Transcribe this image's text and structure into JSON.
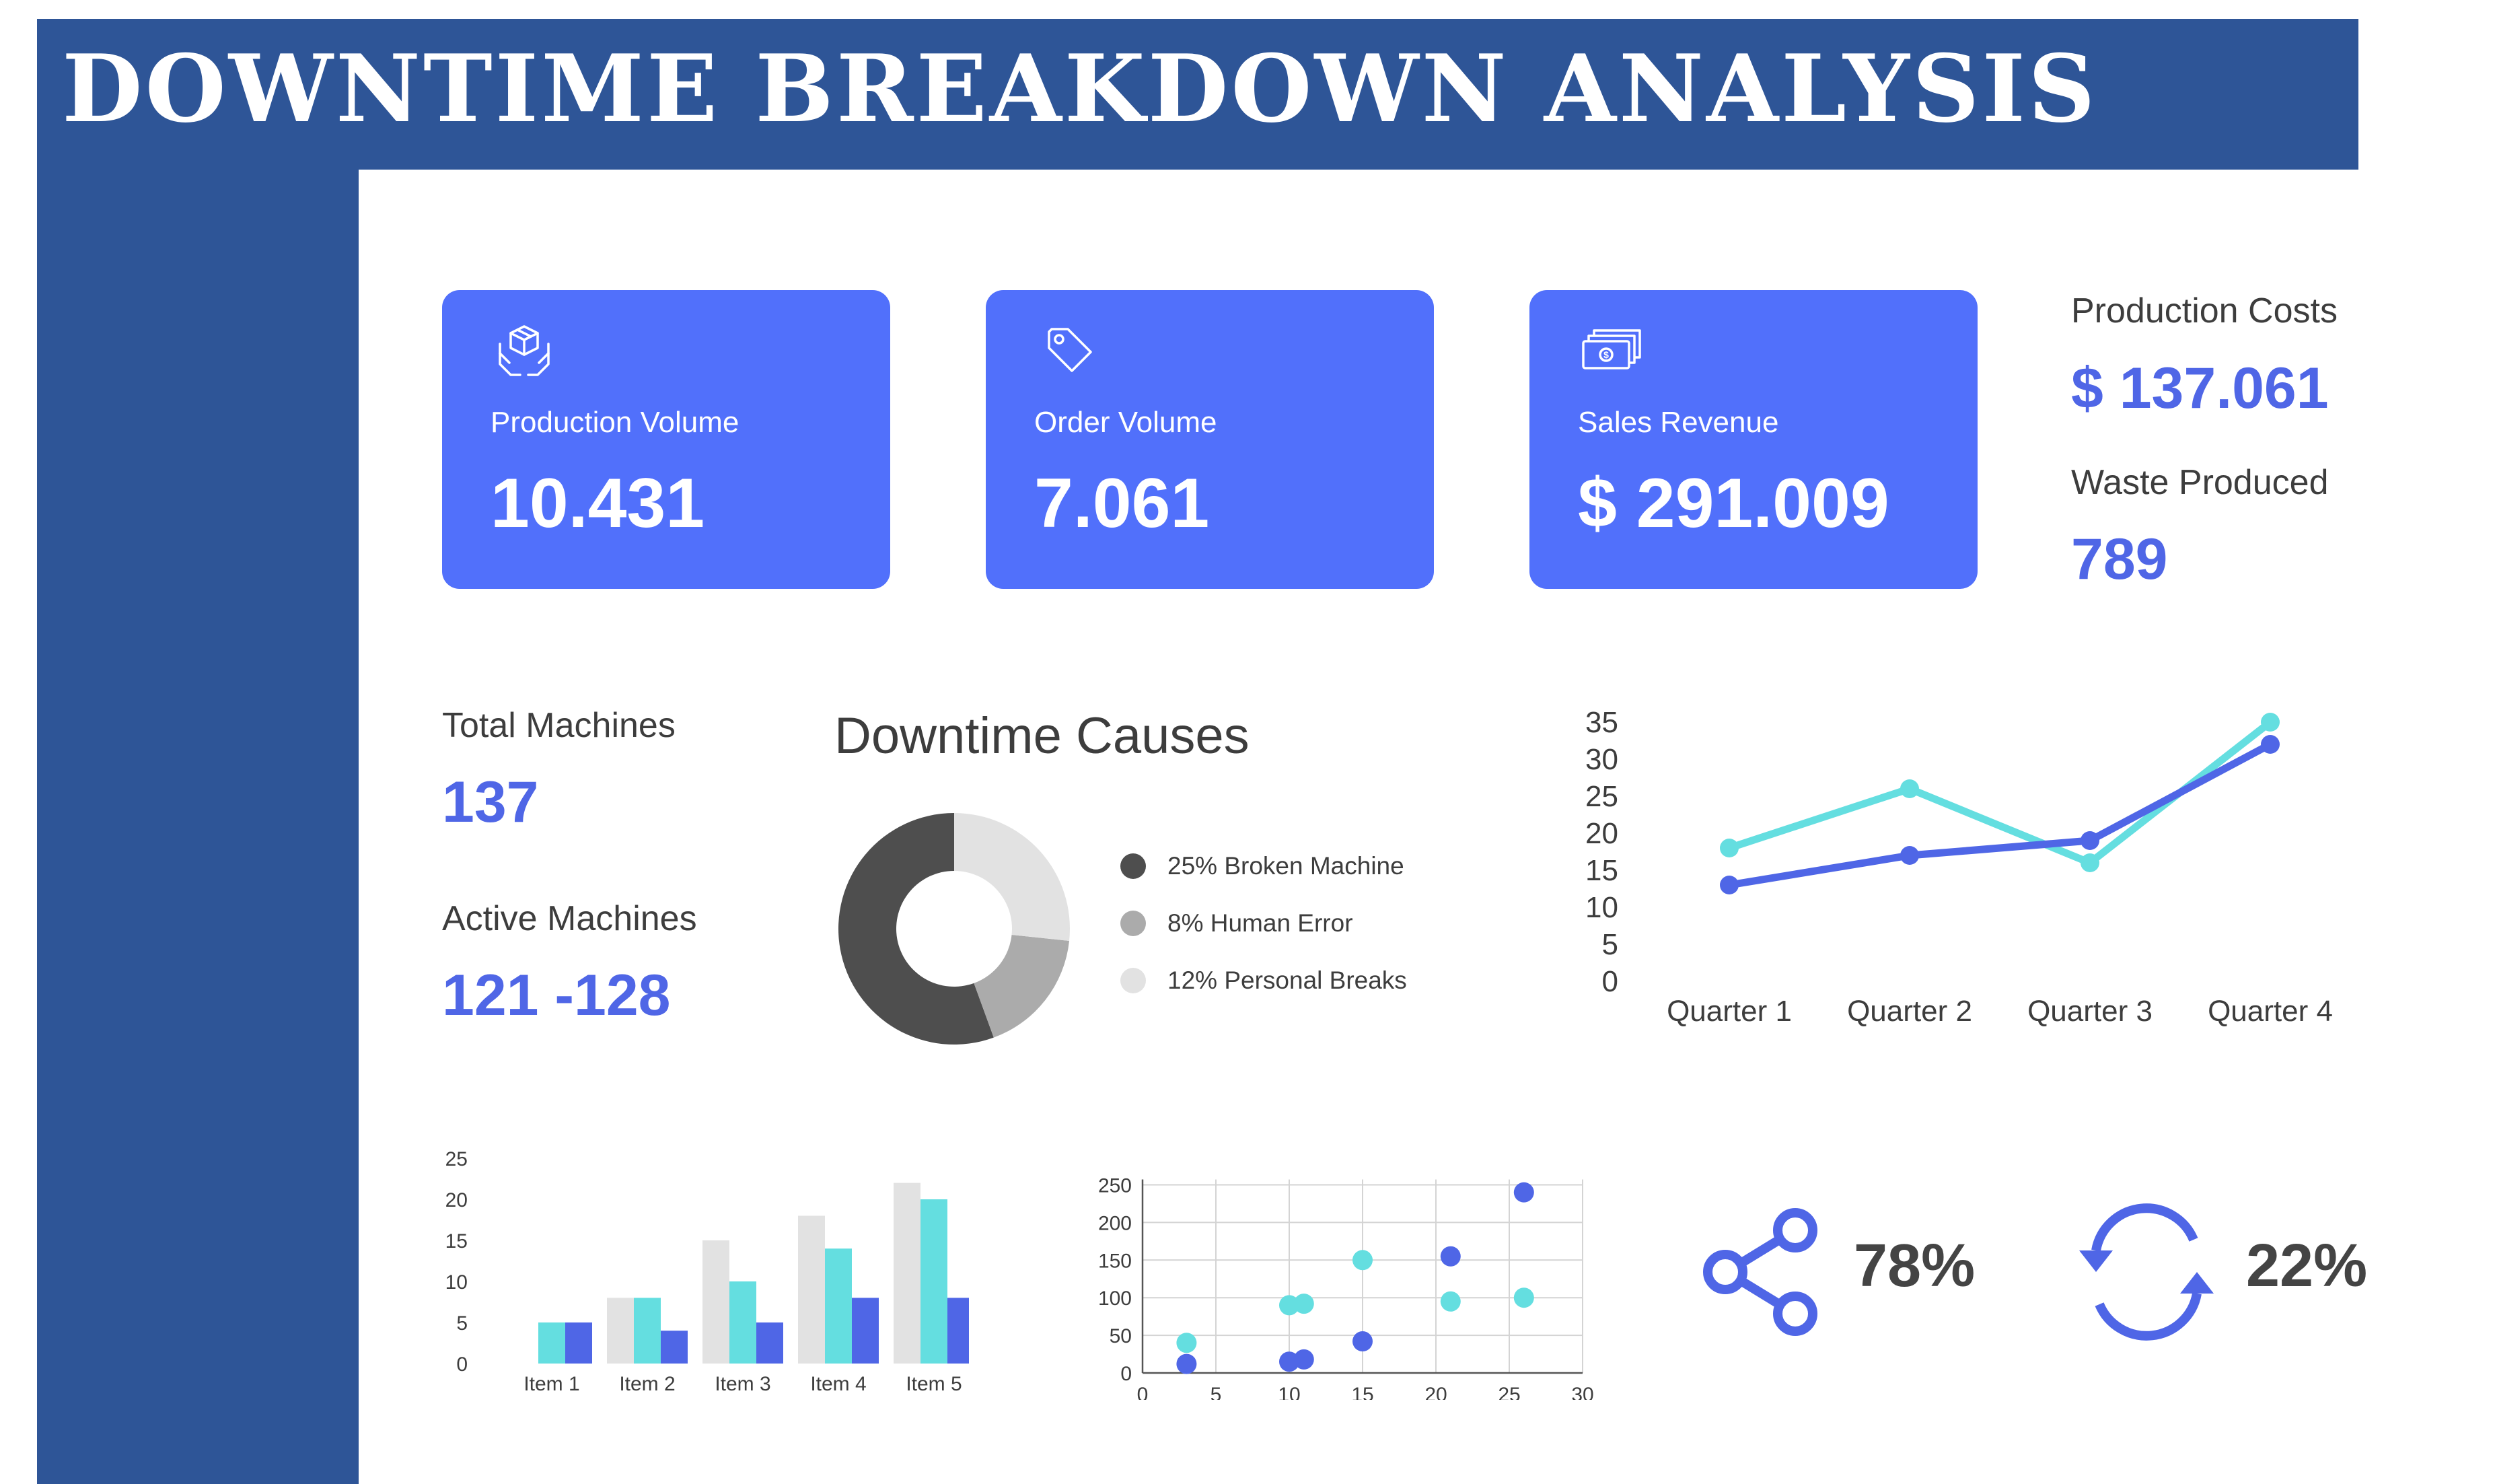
{
  "header": {
    "title": "Downtime Breakdown Analysis"
  },
  "colors": {
    "frame": "#2E5597",
    "card": "#5170FB",
    "accent_blue": "#4F66E6",
    "teal": "#64DEE0",
    "dark": "#4E4E4E",
    "mid_gray": "#ABABAB",
    "light_gray": "#E2E2E2"
  },
  "kpis": [
    {
      "icon": "hands-box-icon",
      "label": "Production Volume",
      "value": "10.431"
    },
    {
      "icon": "price-tag-icon",
      "label": "Order Volume",
      "value": "7.061"
    },
    {
      "icon": "cash-stack-icon",
      "label": "Sales Revenue",
      "value": "$ 291.009"
    }
  ],
  "side_stats": {
    "production_costs": {
      "label": "Production Costs",
      "value": "$ 137.061"
    },
    "waste_produced": {
      "label": "Waste Produced",
      "value": "789"
    }
  },
  "machines": {
    "total": {
      "label": "Total Machines",
      "value": "137"
    },
    "active": {
      "label": "Active Machines",
      "value": "121 -128"
    }
  },
  "shares": [
    {
      "icon": "share-icon",
      "value": "78%"
    },
    {
      "icon": "refresh-icon",
      "value": "22%"
    }
  ],
  "chart_data": [
    {
      "type": "pie",
      "title": "Downtime Causes",
      "donut": true,
      "slices": [
        {
          "label": "25% Broken Machine",
          "value": 25,
          "color": "#4E4E4E"
        },
        {
          "label": "8% Human Error",
          "value": 8,
          "color": "#ABABAB"
        },
        {
          "label": "12% Personal Breaks",
          "value": 12,
          "color": "#E2E2E2"
        }
      ],
      "legend": "right"
    },
    {
      "type": "line",
      "categories": [
        "Quarter 1",
        "Quarter 2",
        "Quarter 3",
        "Quarter 4"
      ],
      "series": [
        {
          "values": [
            18,
            26,
            16,
            35
          ],
          "color": "#64DEE0"
        },
        {
          "values": [
            13,
            17,
            19,
            32
          ],
          "color": "#4F66E6"
        }
      ],
      "ylim": [
        0,
        35
      ],
      "yticks": [
        0,
        5,
        10,
        15,
        20,
        25,
        30,
        35
      ],
      "grid": false
    },
    {
      "type": "bar",
      "categories": [
        "Item 1",
        "Item 2",
        "Item 3",
        "Item 4",
        "Item 5"
      ],
      "series": [
        {
          "values": [
            0,
            8,
            15,
            18,
            22
          ],
          "color": "#E2E2E2"
        },
        {
          "values": [
            5,
            8,
            10,
            14,
            20
          ],
          "color": "#64DEE0"
        },
        {
          "values": [
            5,
            4,
            5,
            8,
            8
          ],
          "color": "#4F66E6"
        }
      ],
      "ylim": [
        0,
        25
      ],
      "yticks": [
        0,
        5,
        10,
        15,
        20,
        25
      ],
      "grid": false
    },
    {
      "type": "scatter",
      "series": [
        {
          "points": [
            [
              3,
              40
            ],
            [
              10,
              90
            ],
            [
              11,
              92
            ],
            [
              15,
              150
            ],
            [
              21,
              95
            ],
            [
              26,
              100
            ]
          ],
          "color": "#64DEE0"
        },
        {
          "points": [
            [
              3,
              12
            ],
            [
              10,
              15
            ],
            [
              11,
              18
            ],
            [
              15,
              42
            ],
            [
              21,
              155
            ],
            [
              26,
              240
            ]
          ],
          "color": "#4F66E6"
        }
      ],
      "xlim": [
        0,
        30
      ],
      "ylim": [
        0,
        250
      ],
      "xticks": [
        0,
        5,
        10,
        15,
        20,
        25,
        30
      ],
      "yticks": [
        0,
        50,
        100,
        150,
        200,
        250
      ],
      "grid": true
    }
  ]
}
